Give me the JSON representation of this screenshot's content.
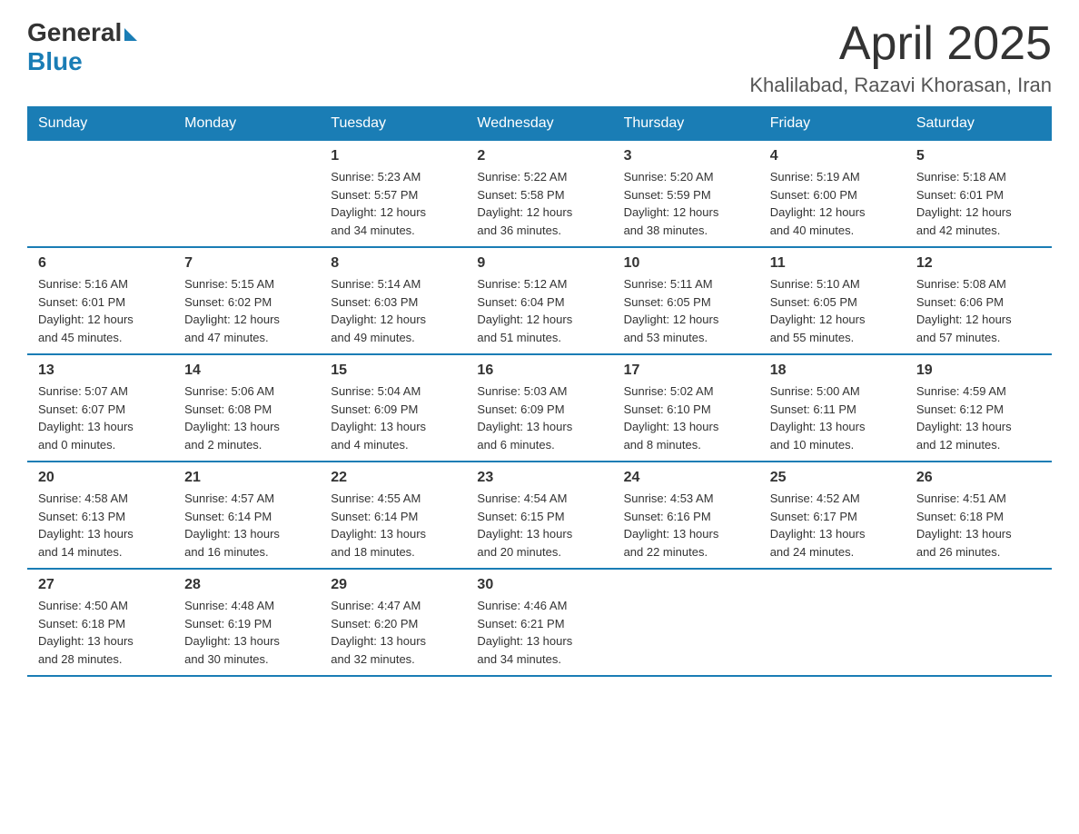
{
  "header": {
    "logo_general": "General",
    "logo_blue": "Blue",
    "month_year": "April 2025",
    "location": "Khalilabad, Razavi Khorasan, Iran"
  },
  "weekdays": [
    "Sunday",
    "Monday",
    "Tuesday",
    "Wednesday",
    "Thursday",
    "Friday",
    "Saturday"
  ],
  "weeks": [
    [
      {
        "day": "",
        "info": ""
      },
      {
        "day": "",
        "info": ""
      },
      {
        "day": "1",
        "info": "Sunrise: 5:23 AM\nSunset: 5:57 PM\nDaylight: 12 hours\nand 34 minutes."
      },
      {
        "day": "2",
        "info": "Sunrise: 5:22 AM\nSunset: 5:58 PM\nDaylight: 12 hours\nand 36 minutes."
      },
      {
        "day": "3",
        "info": "Sunrise: 5:20 AM\nSunset: 5:59 PM\nDaylight: 12 hours\nand 38 minutes."
      },
      {
        "day": "4",
        "info": "Sunrise: 5:19 AM\nSunset: 6:00 PM\nDaylight: 12 hours\nand 40 minutes."
      },
      {
        "day": "5",
        "info": "Sunrise: 5:18 AM\nSunset: 6:01 PM\nDaylight: 12 hours\nand 42 minutes."
      }
    ],
    [
      {
        "day": "6",
        "info": "Sunrise: 5:16 AM\nSunset: 6:01 PM\nDaylight: 12 hours\nand 45 minutes."
      },
      {
        "day": "7",
        "info": "Sunrise: 5:15 AM\nSunset: 6:02 PM\nDaylight: 12 hours\nand 47 minutes."
      },
      {
        "day": "8",
        "info": "Sunrise: 5:14 AM\nSunset: 6:03 PM\nDaylight: 12 hours\nand 49 minutes."
      },
      {
        "day": "9",
        "info": "Sunrise: 5:12 AM\nSunset: 6:04 PM\nDaylight: 12 hours\nand 51 minutes."
      },
      {
        "day": "10",
        "info": "Sunrise: 5:11 AM\nSunset: 6:05 PM\nDaylight: 12 hours\nand 53 minutes."
      },
      {
        "day": "11",
        "info": "Sunrise: 5:10 AM\nSunset: 6:05 PM\nDaylight: 12 hours\nand 55 minutes."
      },
      {
        "day": "12",
        "info": "Sunrise: 5:08 AM\nSunset: 6:06 PM\nDaylight: 12 hours\nand 57 minutes."
      }
    ],
    [
      {
        "day": "13",
        "info": "Sunrise: 5:07 AM\nSunset: 6:07 PM\nDaylight: 13 hours\nand 0 minutes."
      },
      {
        "day": "14",
        "info": "Sunrise: 5:06 AM\nSunset: 6:08 PM\nDaylight: 13 hours\nand 2 minutes."
      },
      {
        "day": "15",
        "info": "Sunrise: 5:04 AM\nSunset: 6:09 PM\nDaylight: 13 hours\nand 4 minutes."
      },
      {
        "day": "16",
        "info": "Sunrise: 5:03 AM\nSunset: 6:09 PM\nDaylight: 13 hours\nand 6 minutes."
      },
      {
        "day": "17",
        "info": "Sunrise: 5:02 AM\nSunset: 6:10 PM\nDaylight: 13 hours\nand 8 minutes."
      },
      {
        "day": "18",
        "info": "Sunrise: 5:00 AM\nSunset: 6:11 PM\nDaylight: 13 hours\nand 10 minutes."
      },
      {
        "day": "19",
        "info": "Sunrise: 4:59 AM\nSunset: 6:12 PM\nDaylight: 13 hours\nand 12 minutes."
      }
    ],
    [
      {
        "day": "20",
        "info": "Sunrise: 4:58 AM\nSunset: 6:13 PM\nDaylight: 13 hours\nand 14 minutes."
      },
      {
        "day": "21",
        "info": "Sunrise: 4:57 AM\nSunset: 6:14 PM\nDaylight: 13 hours\nand 16 minutes."
      },
      {
        "day": "22",
        "info": "Sunrise: 4:55 AM\nSunset: 6:14 PM\nDaylight: 13 hours\nand 18 minutes."
      },
      {
        "day": "23",
        "info": "Sunrise: 4:54 AM\nSunset: 6:15 PM\nDaylight: 13 hours\nand 20 minutes."
      },
      {
        "day": "24",
        "info": "Sunrise: 4:53 AM\nSunset: 6:16 PM\nDaylight: 13 hours\nand 22 minutes."
      },
      {
        "day": "25",
        "info": "Sunrise: 4:52 AM\nSunset: 6:17 PM\nDaylight: 13 hours\nand 24 minutes."
      },
      {
        "day": "26",
        "info": "Sunrise: 4:51 AM\nSunset: 6:18 PM\nDaylight: 13 hours\nand 26 minutes."
      }
    ],
    [
      {
        "day": "27",
        "info": "Sunrise: 4:50 AM\nSunset: 6:18 PM\nDaylight: 13 hours\nand 28 minutes."
      },
      {
        "day": "28",
        "info": "Sunrise: 4:48 AM\nSunset: 6:19 PM\nDaylight: 13 hours\nand 30 minutes."
      },
      {
        "day": "29",
        "info": "Sunrise: 4:47 AM\nSunset: 6:20 PM\nDaylight: 13 hours\nand 32 minutes."
      },
      {
        "day": "30",
        "info": "Sunrise: 4:46 AM\nSunset: 6:21 PM\nDaylight: 13 hours\nand 34 minutes."
      },
      {
        "day": "",
        "info": ""
      },
      {
        "day": "",
        "info": ""
      },
      {
        "day": "",
        "info": ""
      }
    ]
  ]
}
